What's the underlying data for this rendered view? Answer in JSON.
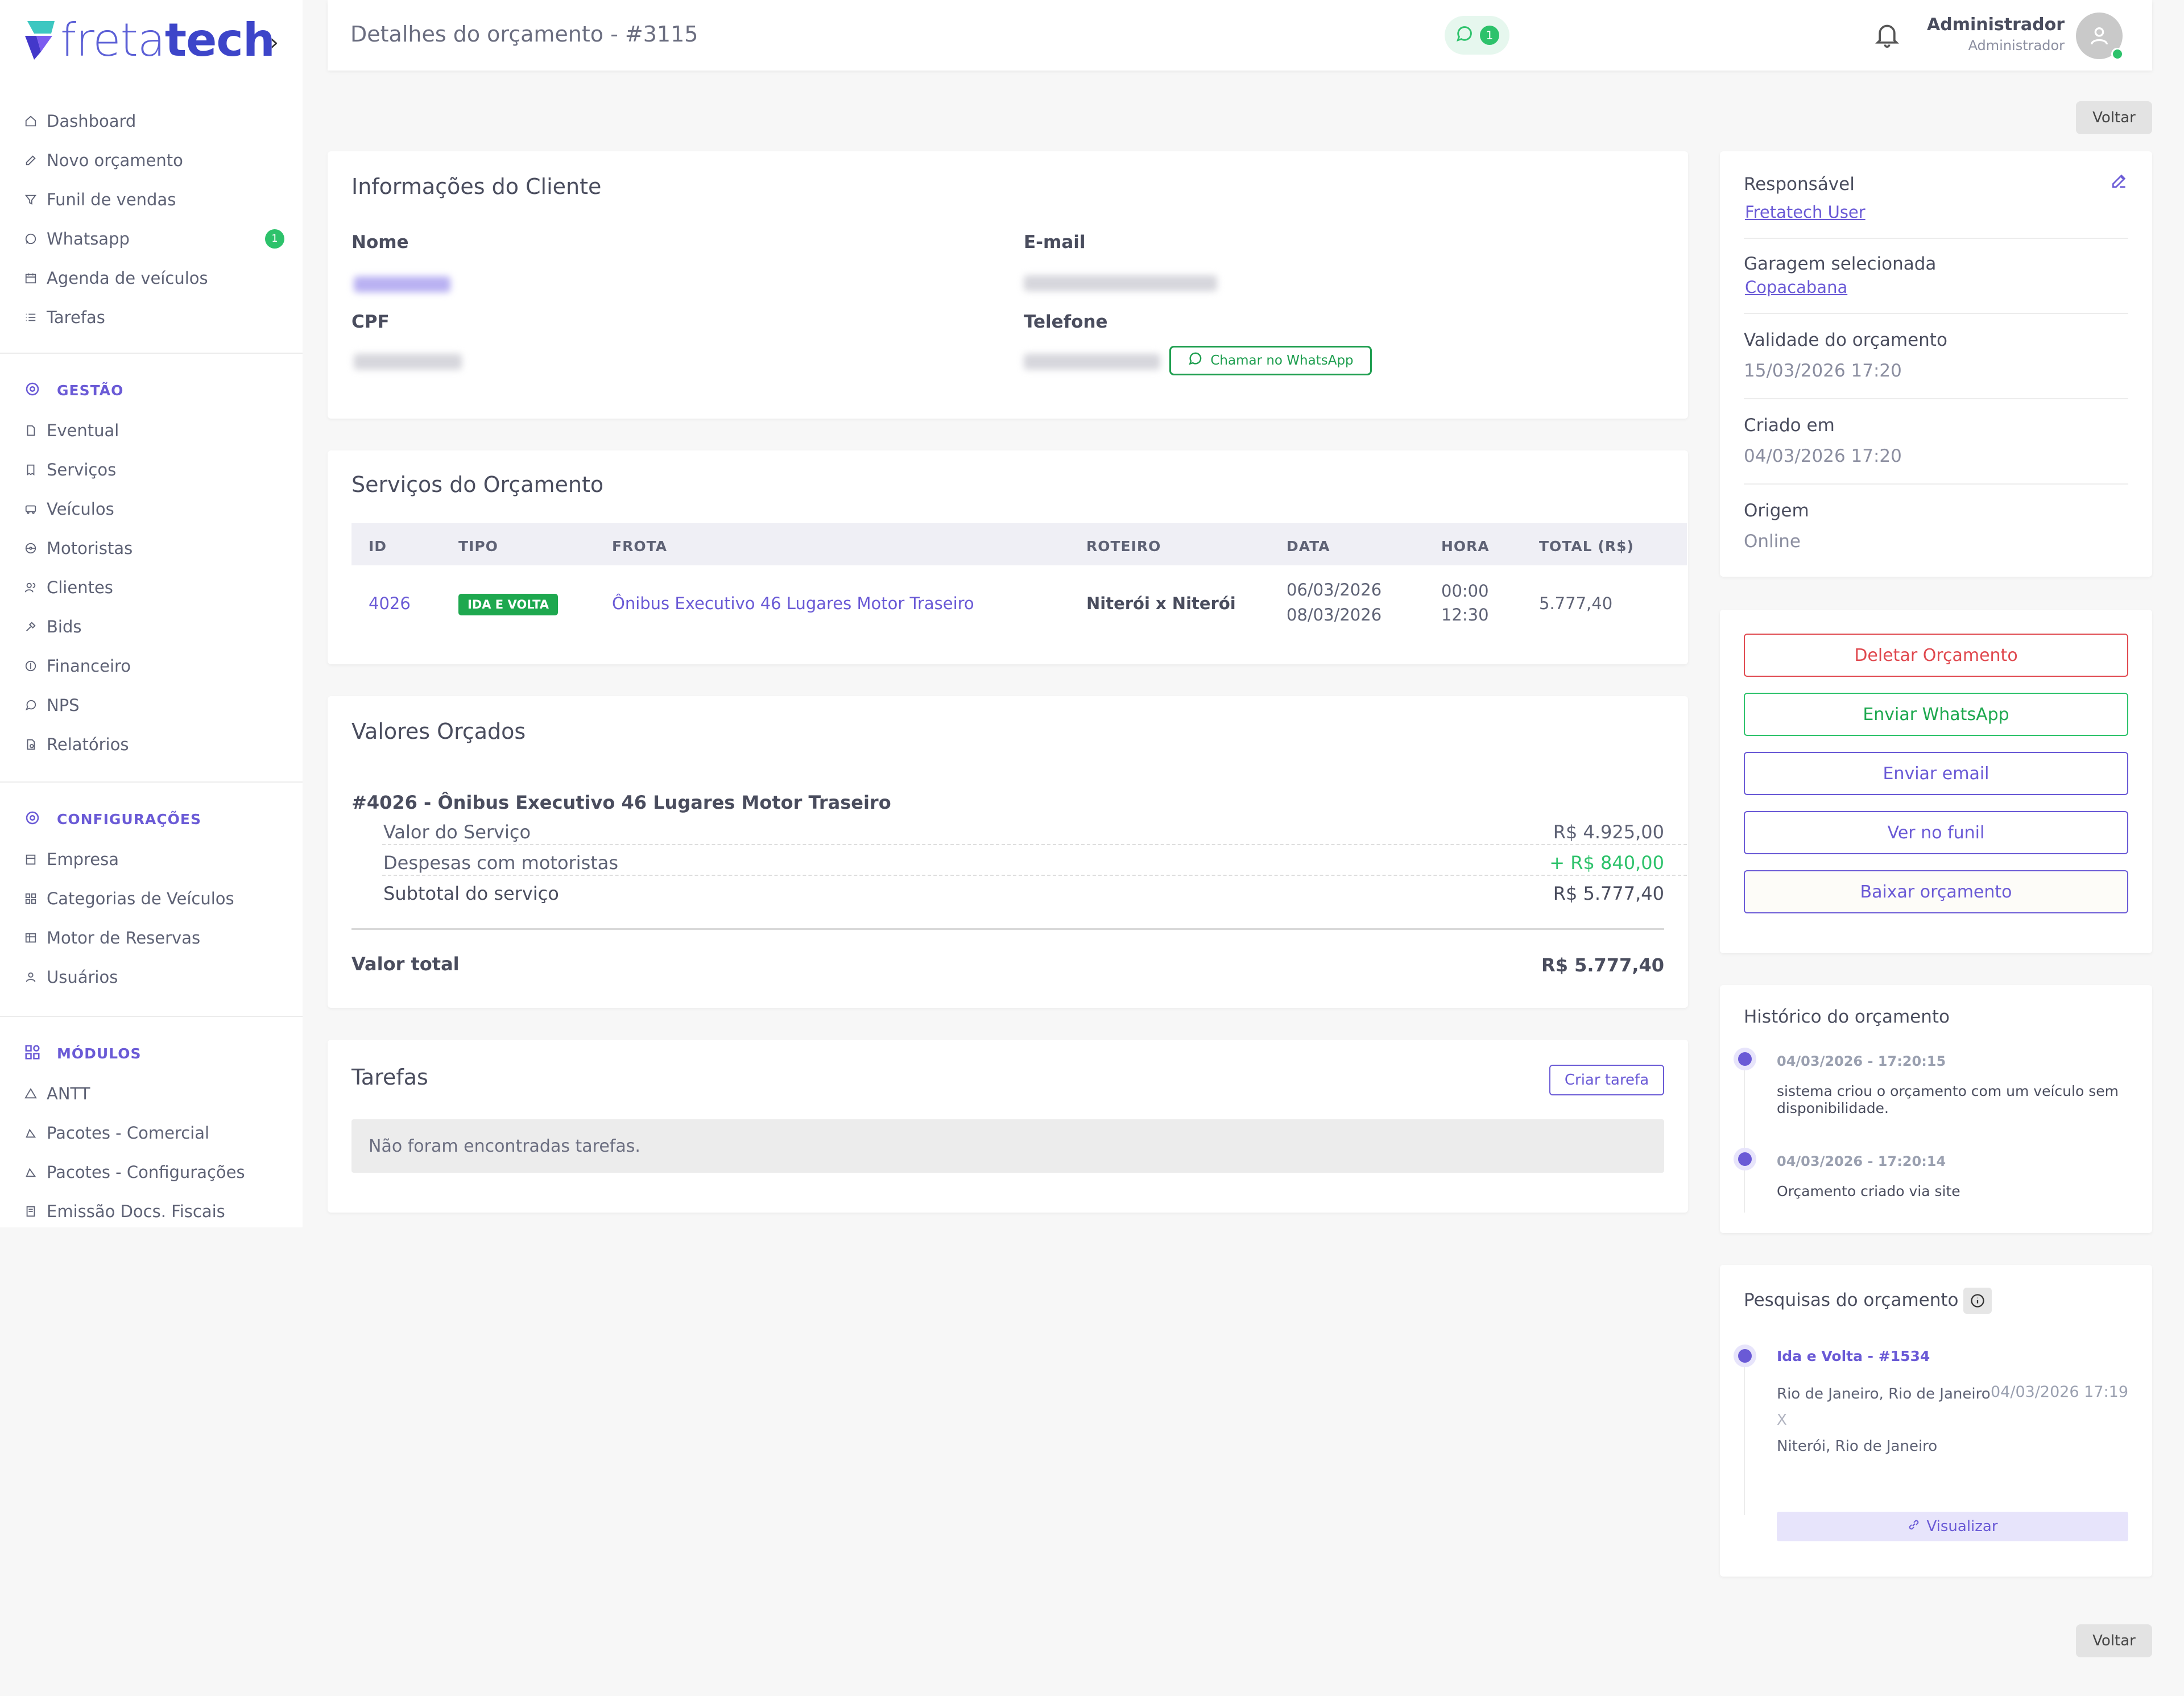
{
  "brand": {
    "logo_part1": "freta",
    "logo_part2": "tech",
    "chevron": "›"
  },
  "sidebar": {
    "items": [
      {
        "label": "Dashboard",
        "icon": "home-icon"
      },
      {
        "label": "Novo orçamento",
        "icon": "edit-icon"
      },
      {
        "label": "Funil de vendas",
        "icon": "funnel-icon"
      },
      {
        "label": "Whatsapp",
        "icon": "whatsapp-icon",
        "badge": "1"
      },
      {
        "label": "Agenda de veículos",
        "icon": "calendar-icon"
      },
      {
        "label": "Tarefas",
        "icon": "list-icon"
      }
    ],
    "gestao": {
      "title": "GESTÃO",
      "items": [
        {
          "label": "Eventual",
          "icon": "document-icon"
        },
        {
          "label": "Serviços",
          "icon": "receipt-icon"
        },
        {
          "label": "Veículos",
          "icon": "bus-icon"
        },
        {
          "label": "Motoristas",
          "icon": "steering-wheel-icon"
        },
        {
          "label": "Clientes",
          "icon": "users-icon"
        },
        {
          "label": "Bids",
          "icon": "gavel-icon"
        },
        {
          "label": "Financeiro",
          "icon": "coin-icon"
        },
        {
          "label": "NPS",
          "icon": "chat-icon"
        },
        {
          "label": "Relatórios",
          "icon": "report-icon"
        }
      ]
    },
    "config": {
      "title": "CONFIGURAÇÕES",
      "items": [
        {
          "label": "Empresa",
          "icon": "building-icon"
        },
        {
          "label": "Categorias de Veículos",
          "icon": "grid-icon"
        },
        {
          "label": "Motor de Reservas",
          "icon": "table-icon"
        },
        {
          "label": "Usuários",
          "icon": "user-icon"
        }
      ]
    },
    "modulos": {
      "title": "MÓDULOS",
      "items": [
        {
          "label": "ANTT",
          "icon": "triangle-icon"
        },
        {
          "label": "Pacotes - Comercial",
          "icon": "package-icon"
        },
        {
          "label": "Pacotes - Configurações",
          "icon": "package-icon"
        },
        {
          "label": "Emissão Docs. Fiscais",
          "icon": "invoice-icon"
        }
      ]
    }
  },
  "header": {
    "title": "Detalhes do orçamento - #3115",
    "whatsapp_count": "1",
    "user_name": "Administrador",
    "user_role": "Administrador"
  },
  "back_label": "Voltar",
  "cliente": {
    "title": "Informações do Cliente",
    "nome_label": "Nome",
    "email_label": "E-mail",
    "cpf_label": "CPF",
    "telefone_label": "Telefone",
    "whatsapp_button": "Chamar no WhatsApp"
  },
  "servicos": {
    "title": "Serviços do Orçamento",
    "columns": [
      "ID",
      "TIPO",
      "FROTA",
      "ROTEIRO",
      "DATA",
      "HORA",
      "TOTAL (R$)"
    ],
    "row": {
      "id": "4026",
      "tipo": "IDA E VOLTA",
      "frota": "Ônibus Executivo 46 Lugares Motor Traseiro",
      "roteiro": "Niterói x Niterói",
      "data1": "06/03/2026",
      "data2": "08/03/2026",
      "hora1": "00:00",
      "hora2": "12:30",
      "total": "5.777,40"
    }
  },
  "valores": {
    "title": "Valores Orçados",
    "service_title": "#4026 - Ônibus Executivo 46 Lugares Motor Traseiro",
    "valor_servico_label": "Valor do Serviço",
    "valor_servico": "R$ 4.925,00",
    "despesas_label": "Despesas com motoristas",
    "despesas": "+ R$ 840,00",
    "subtotal_label": "Subtotal do serviço",
    "subtotal": "R$ 5.777,40",
    "total_label": "Valor total",
    "total": "R$ 5.777,40"
  },
  "tarefas": {
    "title": "Tarefas",
    "create_button": "Criar tarefa",
    "empty": "Não foram encontradas tarefas."
  },
  "resumo": {
    "responsavel_label": "Responsável",
    "responsavel": "Fretatech User",
    "garagem_label": "Garagem selecionada",
    "garagem": "Copacabana",
    "validade_label": "Validade do orçamento",
    "validade": "15/03/2026 17:20",
    "criado_label": "Criado em",
    "criado": "04/03/2026 17:20",
    "origem_label": "Origem",
    "origem": "Online"
  },
  "acoes": {
    "deletar": "Deletar Orçamento",
    "whatsapp": "Enviar WhatsApp",
    "email": "Enviar email",
    "funil": "Ver no funil",
    "baixar": "Baixar orçamento"
  },
  "historico": {
    "title": "Histórico do orçamento",
    "events": [
      {
        "date": "04/03/2026 - 17:20:15",
        "text": "sistema criou o orçamento com um veículo sem disponibilidade."
      },
      {
        "date": "04/03/2026 - 17:20:14",
        "text": "Orçamento criado via site"
      }
    ]
  },
  "pesquisas": {
    "title": "Pesquisas do orçamento",
    "item_title": "Ida e Volta - #1534",
    "origin": "Rio de Janeiro, Rio de Janeiro",
    "date": "04/03/2026 17:19",
    "separator": "X",
    "destination": "Niterói, Rio de Janeiro",
    "view_button": "Visualizar"
  },
  "colors": {
    "accent": "#6a5ad6",
    "green": "#2dc26b",
    "red": "#e0494f"
  }
}
